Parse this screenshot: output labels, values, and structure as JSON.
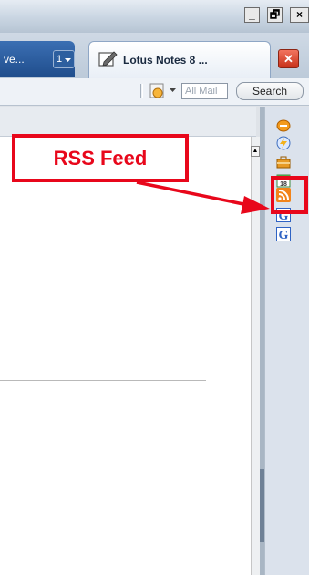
{
  "window": {
    "minimize_label": "_",
    "maximize_label": "🗗",
    "close_label": "×"
  },
  "tabs": {
    "inactive_label": "ve...",
    "tab_count": "1",
    "active_label": "Lotus Notes 8 ...",
    "close_label": "✕"
  },
  "toolbar": {
    "search_placeholder": "All Mail",
    "search_button": "Search"
  },
  "annotation": {
    "callout_label": "RSS Feed",
    "accent_color": "#e8071b"
  },
  "sidebar": {
    "icons": [
      "chat-icon",
      "activities-icon",
      "briefcase-icon",
      "calendar-icon",
      "rss-feed-icon",
      "google-icon",
      "google-icon"
    ],
    "calendar_day": "18",
    "google_letter": "G"
  }
}
